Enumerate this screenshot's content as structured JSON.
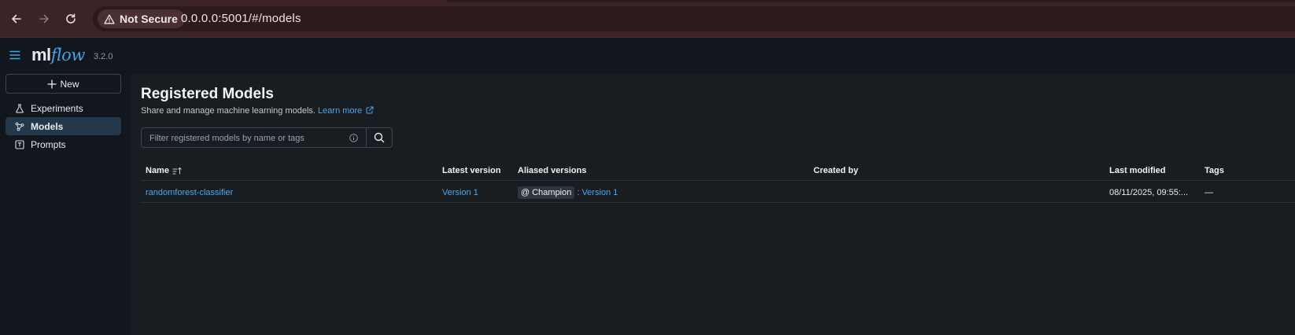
{
  "browser": {
    "security_label": "Not Secure",
    "url": "0.0.0.0:5001/#/models"
  },
  "app": {
    "logo_ml": "ml",
    "logo_flow": "flow",
    "version": "3.2.0",
    "accent_color": "#43a2e6"
  },
  "sidebar": {
    "new_label": "New",
    "items": [
      {
        "label": "Experiments",
        "icon": "beaker-icon",
        "active": false
      },
      {
        "label": "Models",
        "icon": "models-icon",
        "active": true
      },
      {
        "label": "Prompts",
        "icon": "prompt-icon",
        "active": false
      }
    ]
  },
  "page": {
    "title": "Registered Models",
    "subtitle": "Share and manage machine learning models.",
    "learn_more": "Learn more",
    "search_placeholder": "Filter registered models by name or tags"
  },
  "table": {
    "columns": [
      "Name",
      "Latest version",
      "Aliased versions",
      "Created by",
      "Last modified",
      "Tags"
    ],
    "rows": [
      {
        "name": "randomforest-classifier",
        "latest_version": "Version 1",
        "alias": "@ Champion",
        "alias_separator": ":",
        "alias_version": "Version 1",
        "created_by": "",
        "last_modified": "08/11/2025, 09:55:...",
        "tags": "—"
      }
    ]
  }
}
